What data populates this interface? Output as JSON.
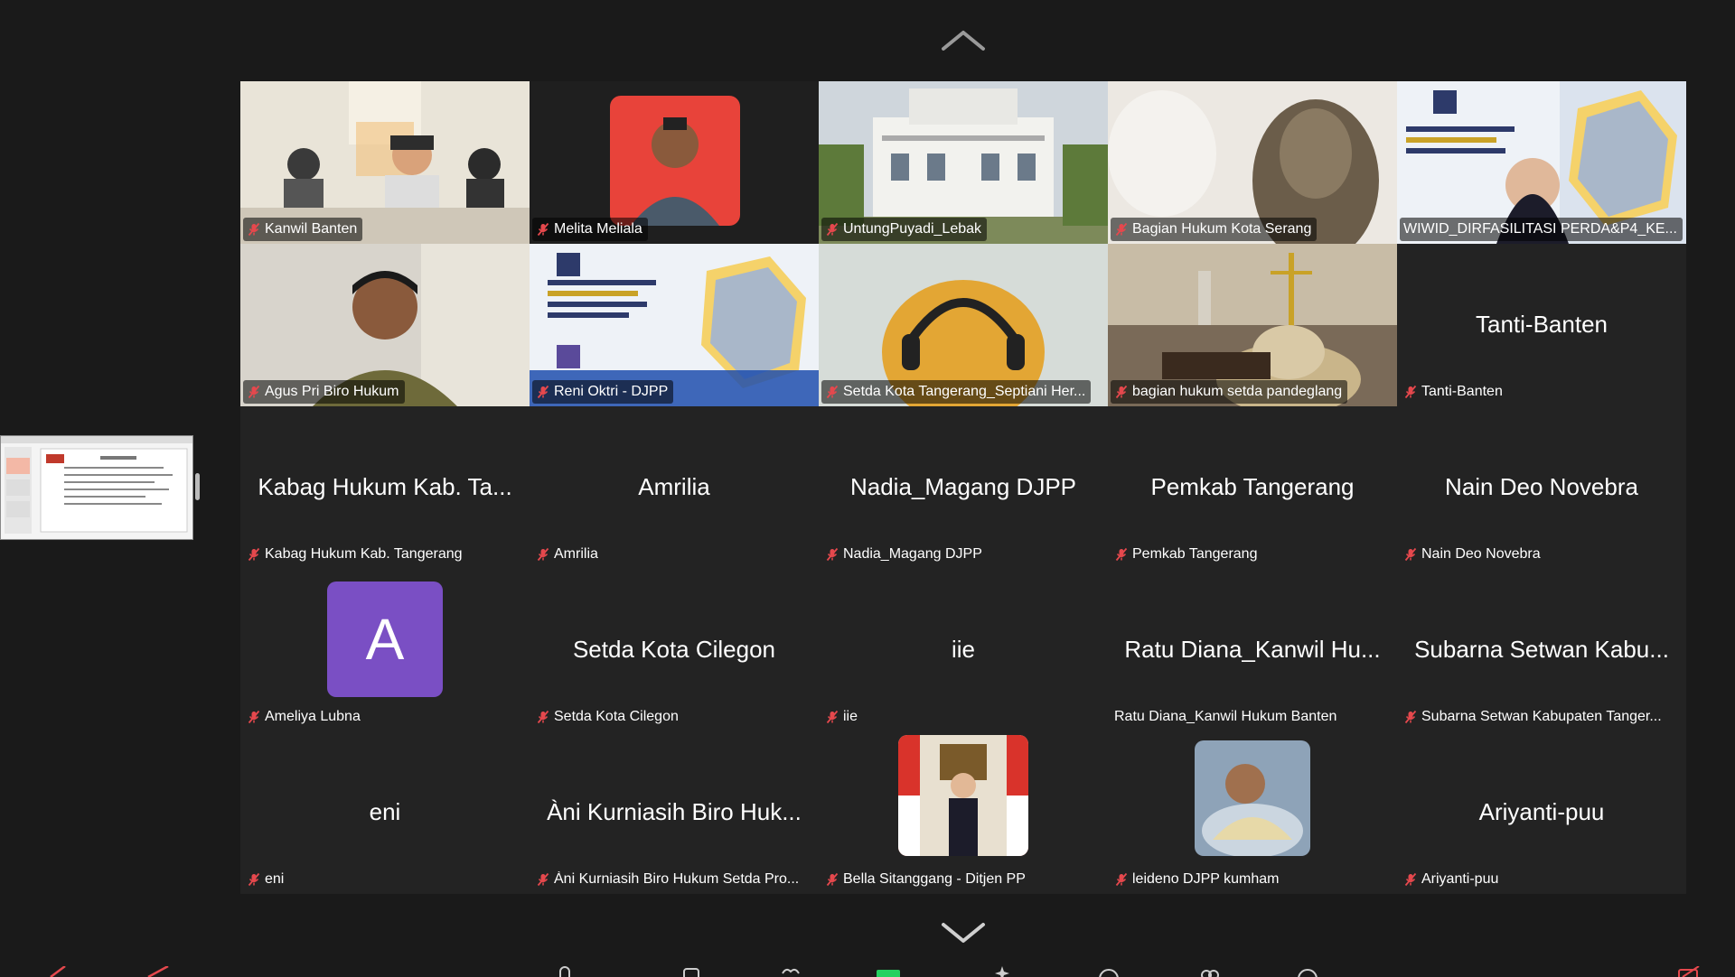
{
  "colors": {
    "background": "#1a1a1a",
    "tile": "#232323",
    "active_border": "#23d160",
    "mic_muted": "#e5484d",
    "avatar_purple": "#7a4fc4"
  },
  "icons": {
    "up": "chevron-up-icon",
    "down": "chevron-down-icon",
    "muted": "mic-off-icon"
  },
  "tiles": [
    {
      "name": "Kanwil Banten",
      "display": "",
      "video": "meeting-room",
      "muted": true
    },
    {
      "name": "Melita Meliala",
      "display": "",
      "video": "portrait-red",
      "muted": true
    },
    {
      "name": "UntungPuyadi_Lebak",
      "display": "",
      "video": "building-bpkad",
      "muted": true
    },
    {
      "name": "Bagian Hukum Kota Serang",
      "display": "",
      "video": "blurred-person",
      "muted": true
    },
    {
      "name": "WIWID_DIRFASILITASI PERDA&P4_KE...",
      "display": "",
      "video": "djpp-background-woman",
      "muted": false,
      "active": true
    },
    {
      "name": "Agus Pri Biro Hukum",
      "display": "",
      "video": "man-office",
      "muted": true
    },
    {
      "name": "Reni Oktri - DJPP",
      "display": "",
      "video": "djpp-background",
      "muted": true
    },
    {
      "name": "Setda Kota Tangerang_Septiani Her...",
      "display": "",
      "video": "headphones-person",
      "muted": true
    },
    {
      "name": "bagian hukum setda pandeglang",
      "display": "",
      "video": "scales-of-justice",
      "muted": true
    },
    {
      "name": "Tanti-Banten",
      "display": "Tanti-Banten",
      "video": "",
      "muted": true
    },
    {
      "name": "Kabag Hukum Kab. Tangerang",
      "display": "Kabag Hukum Kab. Ta...",
      "video": "",
      "muted": true
    },
    {
      "name": "Amrilia",
      "display": "Amrilia",
      "video": "",
      "muted": true
    },
    {
      "name": "Nadia_Magang DJPP",
      "display": "Nadia_Magang DJPP",
      "video": "",
      "muted": true
    },
    {
      "name": "Pemkab Tangerang",
      "display": "Pemkab Tangerang",
      "video": "",
      "muted": true
    },
    {
      "name": "Nain Deo Novebra",
      "display": "Nain Deo Novebra",
      "video": "",
      "muted": true
    },
    {
      "name": "Ameliya Lubna",
      "display": "",
      "video": "",
      "avatar_letter": "A",
      "muted": true
    },
    {
      "name": "Setda Kota Cilegon",
      "display": "Setda Kota Cilegon",
      "video": "",
      "muted": true
    },
    {
      "name": "iie",
      "display": "iie",
      "video": "",
      "muted": true
    },
    {
      "name": "Ratu Diana_Kanwil Hukum Banten",
      "display": "Ratu Diana_Kanwil Hu...",
      "video": "",
      "muted": false
    },
    {
      "name": "Subarna Setwan Kabupaten Tanger...",
      "display": "Subarna Setwan Kabu...",
      "video": "",
      "muted": true
    },
    {
      "name": "eni",
      "display": "eni",
      "video": "",
      "muted": true
    },
    {
      "name": "Àni Kurniasih Biro Hukum Setda Pro...",
      "display": "Àni Kurniasih Biro Huk...",
      "video": "",
      "muted": true
    },
    {
      "name": "Bella Sitanggang - Ditjen PP",
      "display": "",
      "video": "",
      "avatar_photo": "flags-portrait",
      "muted": true
    },
    {
      "name": "leideno DJPP kumham",
      "display": "",
      "video": "",
      "avatar_photo": "baby-photo",
      "muted": true
    },
    {
      "name": "Ariyanti-puu",
      "display": "Ariyanti-puu",
      "video": "",
      "muted": true
    }
  ]
}
